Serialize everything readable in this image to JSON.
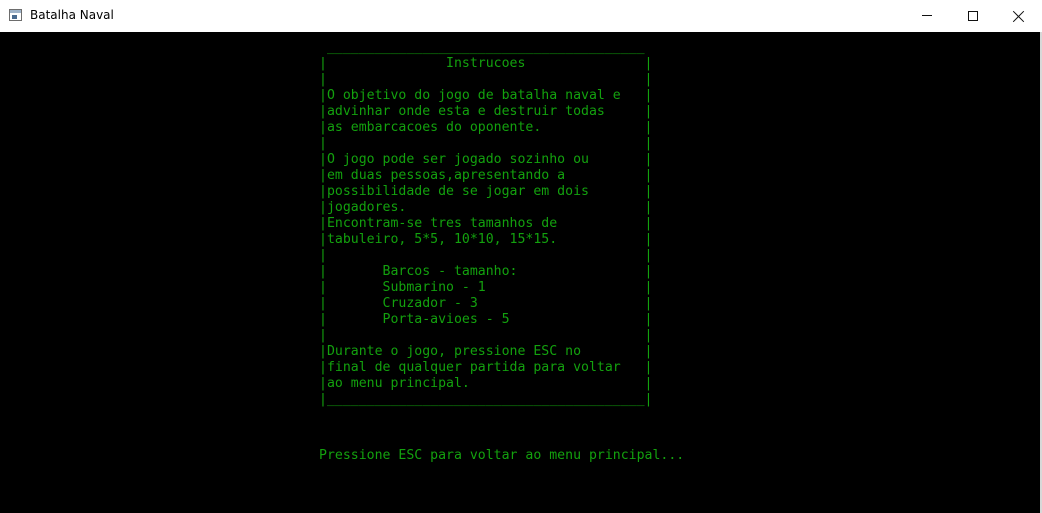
{
  "window": {
    "title": "Batalha Naval"
  },
  "controls": {
    "minimize_icon": "minimize-icon",
    "maximize_icon": "maximize-icon",
    "close_icon": "close-icon"
  },
  "colors": {
    "console_background": "#000000",
    "console_text": "#13a10e",
    "titlebar_background": "#ffffff"
  },
  "instructions_box": {
    "lines": [
      " ________________________________________",
      "|               Instrucoes               |",
      "|                                        |",
      "|O objetivo do jogo de batalha naval e   |",
      "|advinhar onde esta e destruir todas     |",
      "|as embarcacoes do oponente.             |",
      "|                                        |",
      "|O jogo pode ser jogado sozinho ou       |",
      "|em duas pessoas,apresentando a          |",
      "|possibilidade de se jogar em dois       |",
      "|jogadores.                              |",
      "|Encontram-se tres tamanhos de           |",
      "|tabuleiro, 5*5, 10*10, 15*15.           |",
      "|                                        |",
      "|       Barcos - tamanho:                |",
      "|       Submarino - 1                    |",
      "|       Cruzador - 3                     |",
      "|       Porta-avioes - 5                 |",
      "|                                        |",
      "|Durante o jogo, pressione ESC no        |",
      "|final de qualquer partida para voltar   |",
      "|ao menu principal.                      |",
      "|________________________________________|"
    ]
  },
  "prompt": {
    "text": "Pressione ESC para voltar ao menu principal..."
  }
}
